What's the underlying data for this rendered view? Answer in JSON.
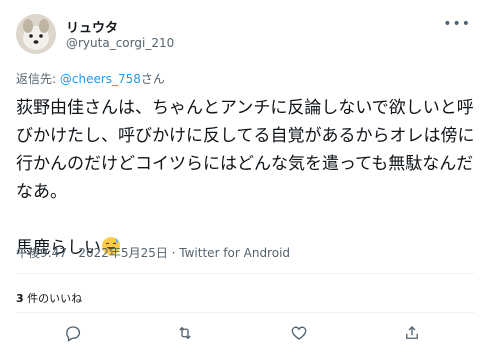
{
  "tweet": {
    "display_name": "リュウタ",
    "handle": "@ryuta_corgi_210",
    "reply_prefix": "返信先: ",
    "reply_to": "@cheers_758",
    "reply_suffix": "さん",
    "text_line1": "荻野由佳さんは、ちゃんとアンチに反論しないで欲しいと呼びかけたし、呼びかけに反してる自覚があるからオレは傍に行かんのだけどコイツらにはどんな気を遣っても無駄なんだなあ。",
    "text_line2": "馬鹿らしい",
    "timestamp": "午後9:47 · 2022年5月25日 · Twitter for Android",
    "likes_count": "3",
    "likes_label": " 件のいいね"
  },
  "icons": {
    "more": "more-dots-icon",
    "reply": "reply-icon",
    "retweet": "retweet-icon",
    "like": "like-icon",
    "share": "share-icon",
    "emoji": "sweat-smile-emoji"
  },
  "colors": {
    "link": "#1d9bf0",
    "secondary": "#536471",
    "divider": "#eff3f4"
  }
}
